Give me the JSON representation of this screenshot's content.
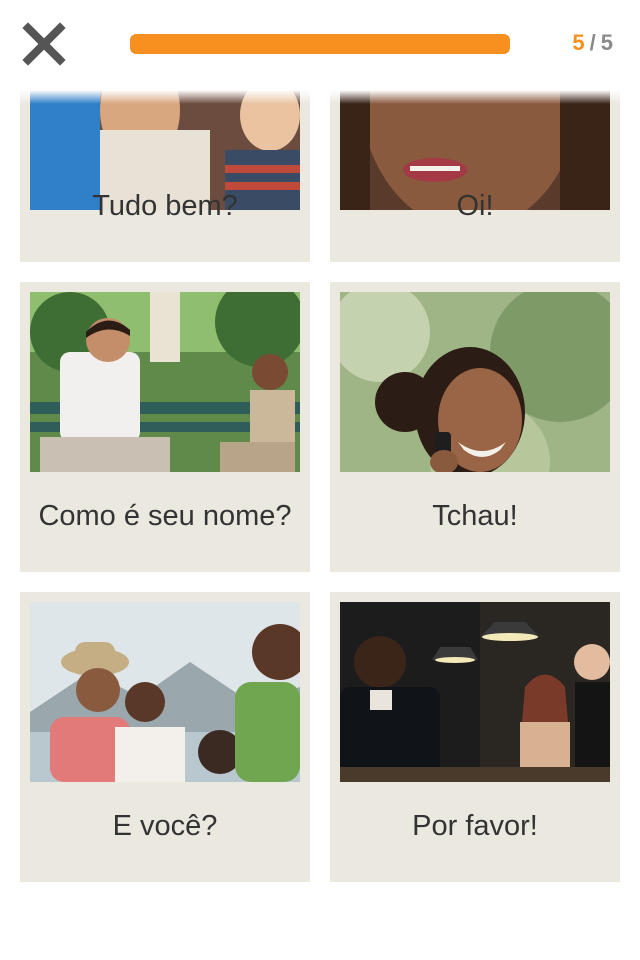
{
  "header": {
    "close_icon": "close-x-icon",
    "progress_fraction": 1.0,
    "progress_color": "#f7901e",
    "counter": {
      "current": "5",
      "separator": "/",
      "total": "5"
    }
  },
  "cards": [
    {
      "label": "Tudo bem?"
    },
    {
      "label": "Oi!"
    },
    {
      "label": "Como é seu nome?"
    },
    {
      "label": "Tchau!"
    },
    {
      "label": "E você?"
    },
    {
      "label": "Por favor!"
    }
  ],
  "colors": {
    "accent": "#f7901e",
    "card_background": "#ebe8e0",
    "text": "#333333"
  }
}
